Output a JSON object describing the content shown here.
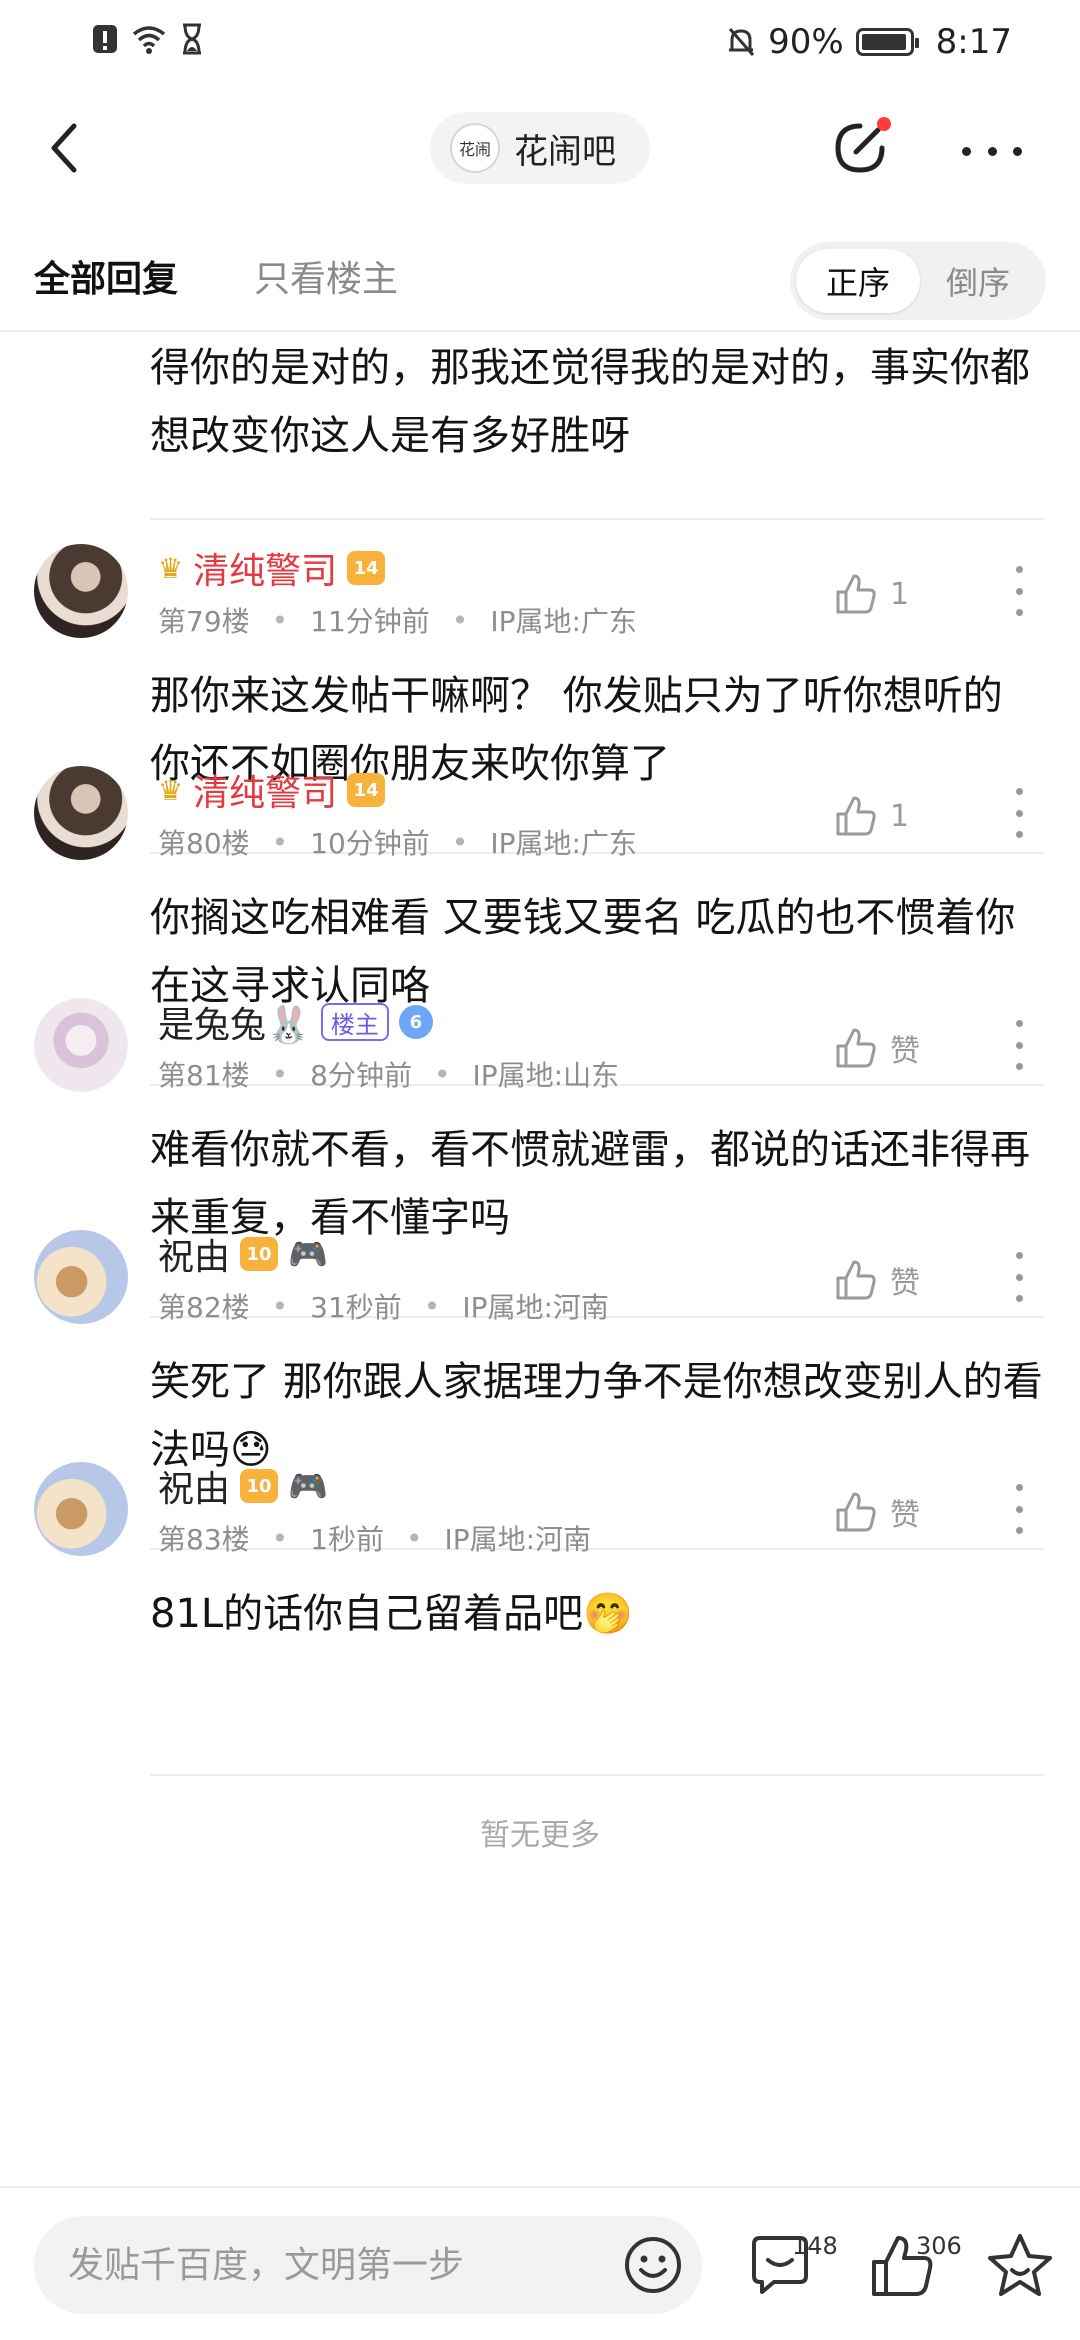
{
  "status_bar": {
    "battery": "90%",
    "time": "8:17"
  },
  "header": {
    "forum_name": "花闹吧",
    "forum_logo_text": "花闹"
  },
  "tabs": {
    "all_replies": "全部回复",
    "owner_only": "只看楼主"
  },
  "order": {
    "ascending": "正序",
    "descending": "倒序"
  },
  "top_fragment": "得你的是对的，那我还觉得我的是对的，事实你都想改变你这人是有多好胜呀",
  "posts": [
    {
      "username": "清纯警司",
      "level": "14",
      "floor": "第79楼",
      "time": "11分钟前",
      "ip": "IP属地:广东",
      "likes": "1",
      "text": "那你来这发帖干嘛啊？ 你发贴只为了听你想听的 你还不如圈你朋友来吹你算了"
    },
    {
      "username": "清纯警司",
      "level": "14",
      "floor": "第80楼",
      "time": "10分钟前",
      "ip": "IP属地:广东",
      "likes": "1",
      "text": "你搁这吃相难看 又要钱又要名 吃瓜的也不惯着你在这寻求认同咯"
    },
    {
      "username": "是兔兔🐰",
      "owner_badge": "楼主",
      "level": "6",
      "floor": "第81楼",
      "time": "8分钟前",
      "ip": "IP属地:山东",
      "likes": "赞",
      "text": "难看你就不看，看不惯就避雷，都说的话还非得再来重复，看不懂字吗"
    },
    {
      "username": "祝由",
      "level": "10",
      "floor": "第82楼",
      "time": "31秒前",
      "ip": "IP属地:河南",
      "likes": "赞",
      "text": "笑死了 那你跟人家据理力争不是你想改变别人的看法吗😓"
    },
    {
      "username": "祝由",
      "level": "10",
      "floor": "第83楼",
      "time": "1秒前",
      "ip": "IP属地:河南",
      "likes": "赞",
      "text": "81L的话你自己留着品吧🤭"
    }
  ],
  "footer_note": "暂无更多",
  "bottom_bar": {
    "compose_placeholder": "发贴千百度，文明第一步",
    "comment_count": "148",
    "like_count": "306"
  }
}
